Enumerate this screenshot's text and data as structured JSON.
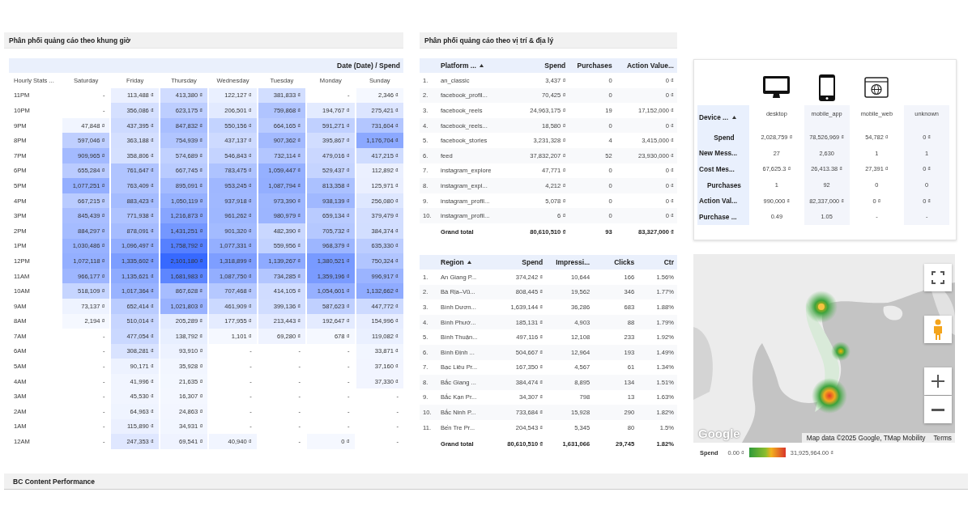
{
  "hourly": {
    "title": "Phân phối quảng cáo theo khung giờ",
    "header": "Date (Date) / Spend",
    "corner": "Hourly Stats ...",
    "columns": [
      "Saturday",
      "Friday",
      "Thursday",
      "Wednesday",
      "Tuesday",
      "Monday",
      "Sunday"
    ],
    "rows": [
      {
        "label": "11PM",
        "values": [
          "-",
          "113,488 ₫",
          "413,380 ₫",
          "122,127 ₫",
          "381,833 ₫",
          "-",
          "2,346 ₫"
        ]
      },
      {
        "label": "10PM",
        "values": [
          "-",
          "356,086 ₫",
          "623,175 ₫",
          "206,501 ₫",
          "759,868 ₫",
          "194,767 ₫",
          "275,421 ₫"
        ]
      },
      {
        "label": "9PM",
        "values": [
          "47,848 ₫",
          "437,395 ₫",
          "847,832 ₫",
          "550,156 ₫",
          "664,165 ₫",
          "591,271 ₫",
          "731,604 ₫"
        ]
      },
      {
        "label": "8PM",
        "values": [
          "597,046 ₫",
          "363,188 ₫",
          "754,939 ₫",
          "437,137 ₫",
          "907,362 ₫",
          "395,867 ₫",
          "1,176,704 ₫"
        ]
      },
      {
        "label": "7PM",
        "values": [
          "909,965 ₫",
          "358,806 ₫",
          "574,689 ₫",
          "546,843 ₫",
          "732,114 ₫",
          "479,016 ₫",
          "417,215 ₫"
        ]
      },
      {
        "label": "6PM",
        "values": [
          "655,284 ₫",
          "761,647 ₫",
          "667,745 ₫",
          "783,475 ₫",
          "1,059,447 ₫",
          "529,437 ₫",
          "112,892 ₫"
        ]
      },
      {
        "label": "5PM",
        "values": [
          "1,077,251 ₫",
          "763,409 ₫",
          "895,091 ₫",
          "953,245 ₫",
          "1,087,794 ₫",
          "813,358 ₫",
          "125,971 ₫"
        ]
      },
      {
        "label": "4PM",
        "values": [
          "667,215 ₫",
          "883,423 ₫",
          "1,050,119 ₫",
          "937,918 ₫",
          "973,390 ₫",
          "938,139 ₫",
          "256,080 ₫"
        ]
      },
      {
        "label": "3PM",
        "values": [
          "845,439 ₫",
          "771,938 ₫",
          "1,216,873 ₫",
          "961,262 ₫",
          "980,979 ₫",
          "659,134 ₫",
          "379,479 ₫"
        ]
      },
      {
        "label": "2PM",
        "values": [
          "884,297 ₫",
          "878,091 ₫",
          "1,431,251 ₫",
          "901,320 ₫",
          "482,390 ₫",
          "705,732 ₫",
          "384,374 ₫"
        ]
      },
      {
        "label": "1PM",
        "values": [
          "1,030,486 ₫",
          "1,096,497 ₫",
          "1,758,792 ₫",
          "1,077,331 ₫",
          "559,956 ₫",
          "968,379 ₫",
          "635,330 ₫"
        ]
      },
      {
        "label": "12PM",
        "values": [
          "1,072,118 ₫",
          "1,335,602 ₫",
          "2,101,180 ₫",
          "1,318,899 ₫",
          "1,139,267 ₫",
          "1,380,521 ₫",
          "750,324 ₫"
        ]
      },
      {
        "label": "11AM",
        "values": [
          "966,177 ₫",
          "1,135,621 ₫",
          "1,681,983 ₫",
          "1,087,750 ₫",
          "734,285 ₫",
          "1,359,196 ₫",
          "996,917 ₫"
        ]
      },
      {
        "label": "10AM",
        "values": [
          "518,109 ₫",
          "1,017,364 ₫",
          "867,628 ₫",
          "707,468 ₫",
          "414,105 ₫",
          "1,054,601 ₫",
          "1,132,662 ₫"
        ]
      },
      {
        "label": "9AM",
        "values": [
          "73,137 ₫",
          "652,414 ₫",
          "1,021,803 ₫",
          "461,909 ₫",
          "399,136 ₫",
          "587,623 ₫",
          "447,772 ₫"
        ]
      },
      {
        "label": "8AM",
        "values": [
          "2,194 ₫",
          "510,014 ₫",
          "205,289 ₫",
          "177,955 ₫",
          "213,443 ₫",
          "192,647 ₫",
          "154,996 ₫"
        ]
      },
      {
        "label": "7AM",
        "values": [
          "-",
          "477,054 ₫",
          "138,792 ₫",
          "1,101 ₫",
          "69,280 ₫",
          "678 ₫",
          "119,082 ₫"
        ]
      },
      {
        "label": "6AM",
        "values": [
          "-",
          "308,281 ₫",
          "93,910 ₫",
          "-",
          "-",
          "-",
          "33,871 ₫"
        ]
      },
      {
        "label": "5AM",
        "values": [
          "-",
          "90,171 ₫",
          "35,928 ₫",
          "-",
          "-",
          "-",
          "37,160 ₫"
        ]
      },
      {
        "label": "4AM",
        "values": [
          "-",
          "41,996 ₫",
          "21,635 ₫",
          "-",
          "-",
          "-",
          "37,330 ₫"
        ]
      },
      {
        "label": "3AM",
        "values": [
          "-",
          "45,530 ₫",
          "16,307 ₫",
          "-",
          "-",
          "-",
          "-"
        ]
      },
      {
        "label": "2AM",
        "values": [
          "-",
          "64,963 ₫",
          "24,863 ₫",
          "-",
          "-",
          "-",
          "-"
        ]
      },
      {
        "label": "1AM",
        "values": [
          "-",
          "115,890 ₫",
          "34,931 ₫",
          "-",
          "-",
          "-",
          "-"
        ]
      },
      {
        "label": "12AM",
        "values": [
          "-",
          "247,353 ₫",
          "69,541 ₫",
          "40,940 ₫",
          "-",
          "0 ₫",
          "-"
        ]
      }
    ]
  },
  "placement": {
    "title": "Phân phối quảng cáo theo vị trí & địa lý",
    "platform_table": {
      "columns": [
        {
          "label": "Platform ...",
          "sorted": true
        },
        {
          "label": "Spend",
          "sorted": false
        },
        {
          "label": "Purchases",
          "sorted": false
        },
        {
          "label": "Action Value...",
          "sorted": false
        }
      ],
      "rows": [
        {
          "index": "1.",
          "cells": [
            "an_classic",
            "3,437 ₫",
            "0",
            "0 ₫"
          ]
        },
        {
          "index": "2.",
          "cells": [
            "facebook_profil...",
            "70,425 ₫",
            "0",
            "0 ₫"
          ]
        },
        {
          "index": "3.",
          "cells": [
            "facebook_reels",
            "24,963,175 ₫",
            "19",
            "17,152,000 ₫"
          ]
        },
        {
          "index": "4.",
          "cells": [
            "facebook_reels...",
            "18,580 ₫",
            "0",
            "0 ₫"
          ]
        },
        {
          "index": "5.",
          "cells": [
            "facebook_stories",
            "3,231,328 ₫",
            "4",
            "3,415,000 ₫"
          ]
        },
        {
          "index": "6.",
          "cells": [
            "feed",
            "37,832,207 ₫",
            "52",
            "23,930,000 ₫"
          ]
        },
        {
          "index": "7.",
          "cells": [
            "instagram_explore",
            "47,771 ₫",
            "0",
            "0 ₫"
          ]
        },
        {
          "index": "8.",
          "cells": [
            "instagram_expl...",
            "4,212 ₫",
            "0",
            "0 ₫"
          ]
        },
        {
          "index": "9.",
          "cells": [
            "instagram_profil...",
            "5,078 ₫",
            "0",
            "0 ₫"
          ]
        },
        {
          "index": "10.",
          "cells": [
            "instagram_profil...",
            "6 ₫",
            "0",
            "0 ₫"
          ]
        }
      ],
      "total": [
        "Grand total",
        "80,610,510 ₫",
        "93",
        "83,327,000 ₫"
      ]
    },
    "region_table": {
      "columns": [
        {
          "label": "Region",
          "sorted": true
        },
        {
          "label": "Spend",
          "sorted": false
        },
        {
          "label": "Impressi...",
          "sorted": false
        },
        {
          "label": "Clicks",
          "sorted": false
        },
        {
          "label": "Ctr",
          "sorted": false
        }
      ],
      "rows": [
        {
          "index": "1.",
          "cells": [
            "An Giang P...",
            "374,242 ₫",
            "10,644",
            "166",
            "1.56%"
          ]
        },
        {
          "index": "2.",
          "cells": [
            "Bà Rịa–Vũ...",
            "808,445 ₫",
            "19,562",
            "346",
            "1.77%"
          ]
        },
        {
          "index": "3.",
          "cells": [
            "Bình Dươn...",
            "1,639,144 ₫",
            "36,286",
            "683",
            "1.88%"
          ]
        },
        {
          "index": "4.",
          "cells": [
            "Bình Phướ...",
            "185,131 ₫",
            "4,903",
            "88",
            "1.79%"
          ]
        },
        {
          "index": "5.",
          "cells": [
            "Bình Thuận...",
            "497,116 ₫",
            "12,108",
            "233",
            "1.92%"
          ]
        },
        {
          "index": "6.",
          "cells": [
            "Bình Định ...",
            "504,667 ₫",
            "12,964",
            "193",
            "1.49%"
          ]
        },
        {
          "index": "7.",
          "cells": [
            "Bạc Liêu Pr...",
            "167,350 ₫",
            "4,567",
            "61",
            "1.34%"
          ]
        },
        {
          "index": "8.",
          "cells": [
            "Bắc Giang ...",
            "384,474 ₫",
            "8,895",
            "134",
            "1.51%"
          ]
        },
        {
          "index": "9.",
          "cells": [
            "Bắc Kạn Pr...",
            "34,307 ₫",
            "798",
            "13",
            "1.63%"
          ]
        },
        {
          "index": "10.",
          "cells": [
            "Bắc Ninh P...",
            "733,684 ₫",
            "15,928",
            "290",
            "1.82%"
          ]
        },
        {
          "index": "11.",
          "cells": [
            "Bến Tre Pr...",
            "204,543 ₫",
            "5,345",
            "80",
            "1.5%"
          ]
        }
      ],
      "total": [
        "Grand total",
        "80,610,510 ₫",
        "1,631,066",
        "29,745",
        "1.82%"
      ]
    }
  },
  "device": {
    "corner": {
      "label": "Device ...",
      "sorted": true
    },
    "columns": [
      {
        "label": "desktop",
        "kind": "monitor"
      },
      {
        "label": "mobile_app",
        "kind": "phone"
      },
      {
        "label": "mobile_web",
        "kind": "browser"
      },
      {
        "label": "unknown",
        "kind": "none"
      }
    ],
    "rows": [
      {
        "label": "Spend",
        "values": [
          "2,028,759 ₫",
          "78,526,969 ₫",
          "54,782 ₫",
          "0 ₫"
        ]
      },
      {
        "label": "New Mess...",
        "values": [
          "27",
          "2,630",
          "1",
          "1"
        ]
      },
      {
        "label": "Cost Mes...",
        "values": [
          "67,625.3 ₫",
          "26,413.38 ₫",
          "27,391 ₫",
          "0 ₫"
        ]
      },
      {
        "label": "Purchases",
        "values": [
          "1",
          "92",
          "0",
          "0"
        ]
      },
      {
        "label": "Action Val...",
        "values": [
          "990,000 ₫",
          "82,337,000 ₫",
          "0 ₫",
          "0 ₫"
        ]
      },
      {
        "label": "Purchase ...",
        "values": [
          "0.49",
          "1.05",
          "-",
          "-"
        ]
      }
    ]
  },
  "map": {
    "kind": "picture",
    "logo": "Google",
    "attribution": "Map data ©2025 Google, TMap Mobility",
    "terms": "Terms",
    "legend": {
      "label": "Spend",
      "min": "0.00 ₫",
      "max": "31,925,964.00 ₫"
    }
  },
  "footer_section": {
    "title": "BC Content Performance"
  }
}
